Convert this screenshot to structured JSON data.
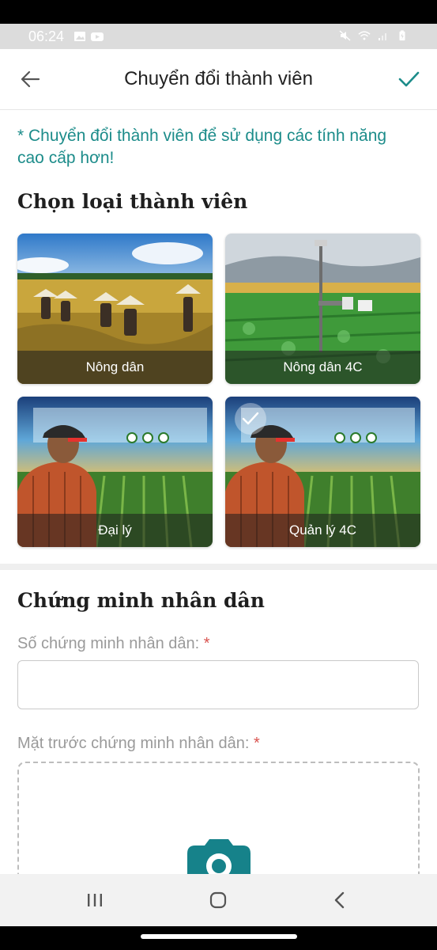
{
  "status_bar": {
    "time": "06:24",
    "icons_left": [
      "image-icon",
      "youtube-icon"
    ],
    "icons_right": [
      "mute-icon",
      "wifi-icon",
      "signal-icon",
      "battery-charging-icon"
    ]
  },
  "header": {
    "title": "Chuyển đổi thành viên",
    "back_icon": "arrow-left-icon",
    "confirm_icon": "check-icon"
  },
  "note": "* Chuyển đổi thành viên để sử dụng các tính năng cao cấp hơn!",
  "member_section": {
    "heading": "Chọn loại thành viên",
    "options": [
      {
        "label": "Nông dân",
        "selected": false
      },
      {
        "label": "Nông dân 4C",
        "selected": false
      },
      {
        "label": "Đại lý",
        "selected": false
      },
      {
        "label": "Quản lý 4C",
        "selected": true
      }
    ]
  },
  "id_section": {
    "heading": "Chứng minh nhân dân",
    "id_number_label": "Số chứng minh nhân dân:",
    "id_number_value": "",
    "front_label": "Mặt trước chứng minh nhân dân:",
    "required_mark": "*",
    "upload_icon": "camera-icon"
  },
  "nav_bar": {
    "icons": [
      "recent-apps-icon",
      "home-icon",
      "back-icon"
    ]
  },
  "colors": {
    "accent": "#1c8c8a",
    "required": "#d9534f"
  }
}
